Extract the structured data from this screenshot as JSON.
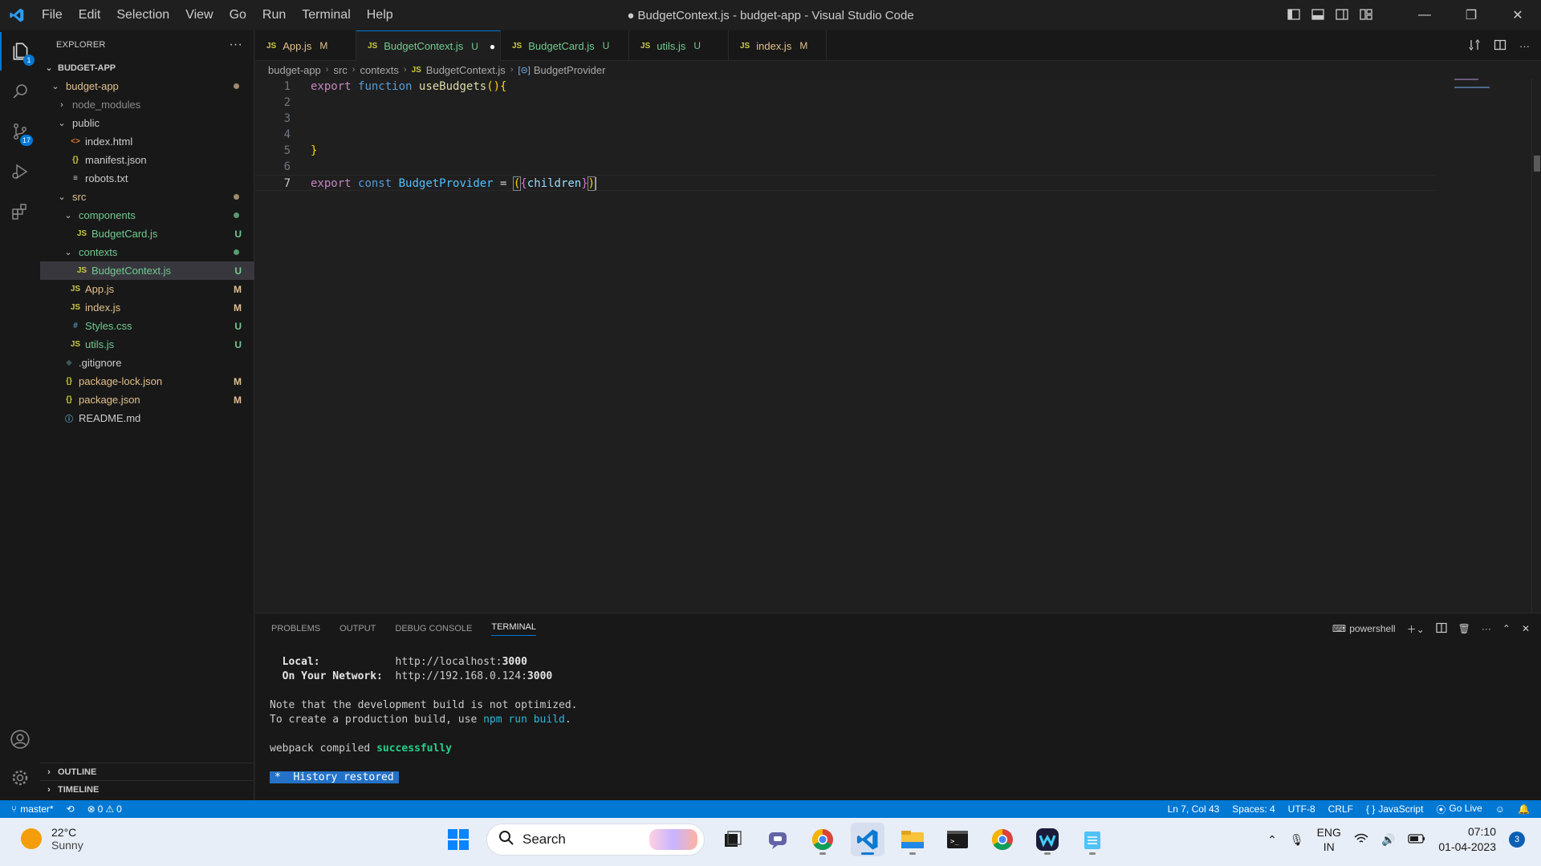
{
  "window": {
    "title": "● BudgetContext.js - budget-app - Visual Studio Code",
    "menu": [
      "File",
      "Edit",
      "Selection",
      "View",
      "Go",
      "Run",
      "Terminal",
      "Help"
    ]
  },
  "activity": {
    "explorer_badge": "1",
    "scm_badge": "17"
  },
  "sidebar": {
    "header": "EXPLORER",
    "more": "···",
    "root": "BUDGET-APP",
    "items": [
      {
        "label": "budget-app",
        "type": "folder",
        "open": true,
        "color": "mod",
        "marker": "dot-mod"
      },
      {
        "label": "node_modules",
        "type": "folder",
        "open": false,
        "color": "dim",
        "marker": ""
      },
      {
        "label": "public",
        "type": "folder",
        "open": true,
        "color": "plain",
        "marker": ""
      },
      {
        "label": "index.html",
        "type": "html",
        "color": "plain",
        "marker": ""
      },
      {
        "label": "manifest.json",
        "type": "json",
        "color": "plain",
        "marker": ""
      },
      {
        "label": "robots.txt",
        "type": "txt",
        "color": "plain",
        "marker": ""
      },
      {
        "label": "src",
        "type": "folder",
        "open": true,
        "color": "mod",
        "marker": "dot-mod"
      },
      {
        "label": "components",
        "type": "folder",
        "open": true,
        "color": "new",
        "marker": "dot-new"
      },
      {
        "label": "BudgetCard.js",
        "type": "js",
        "color": "new",
        "marker": "U"
      },
      {
        "label": "contexts",
        "type": "folder",
        "open": true,
        "color": "new",
        "marker": "dot-new"
      },
      {
        "label": "BudgetContext.js",
        "type": "js",
        "color": "new",
        "marker": "U",
        "selected": true
      },
      {
        "label": "App.js",
        "type": "js",
        "color": "mod",
        "marker": "M"
      },
      {
        "label": "index.js",
        "type": "js",
        "color": "mod",
        "marker": "M"
      },
      {
        "label": "Styles.css",
        "type": "css",
        "color": "new",
        "marker": "U"
      },
      {
        "label": "utils.js",
        "type": "js",
        "color": "new",
        "marker": "U"
      },
      {
        "label": ".gitignore",
        "type": "git",
        "color": "plain",
        "marker": ""
      },
      {
        "label": "package-lock.json",
        "type": "json",
        "color": "mod",
        "marker": "M"
      },
      {
        "label": "package.json",
        "type": "json",
        "color": "mod",
        "marker": "M"
      },
      {
        "label": "README.md",
        "type": "info",
        "color": "plain",
        "marker": ""
      }
    ],
    "outline": "OUTLINE",
    "timeline": "TIMELINE"
  },
  "tabs": [
    {
      "icon": "JS",
      "label": "App.js",
      "status": "M",
      "color": "mod"
    },
    {
      "icon": "JS",
      "label": "BudgetContext.js",
      "status": "U",
      "color": "new",
      "active": true,
      "dirty": "●"
    },
    {
      "icon": "JS",
      "label": "BudgetCard.js",
      "status": "U",
      "color": "new"
    },
    {
      "icon": "JS",
      "label": "utils.js",
      "status": "U",
      "color": "new"
    },
    {
      "icon": "JS",
      "label": "index.js",
      "status": "M",
      "color": "mod"
    }
  ],
  "breadcrumb": [
    "budget-app",
    "src",
    "contexts",
    "BudgetContext.js",
    "BudgetProvider"
  ],
  "editor": {
    "line_numbers": [
      "1",
      "2",
      "3",
      "4",
      "5",
      "6",
      "7"
    ],
    "current_line": "7"
  },
  "panel": {
    "tabs": [
      "PROBLEMS",
      "OUTPUT",
      "DEBUG CONSOLE",
      "TERMINAL"
    ],
    "active_tab": "TERMINAL",
    "shell": "powershell",
    "terminal": {
      "local_label": "Local:",
      "local_prefix": "http://localhost:",
      "local_port": "3000",
      "network_label": "On Your Network:",
      "network_prefix": "http://192.168.0.124:",
      "network_port": "3000",
      "note1": "Note that the development build is not optimized.",
      "note2_pre": "To create a production build, use ",
      "note2_cmd": "npm run build",
      "note2_post": ".",
      "compiled_pre": "webpack compiled ",
      "compiled_word": "successfully",
      "history": "*  History restored"
    }
  },
  "statusbar": {
    "branch": "master*",
    "errors": "0",
    "warnings": "0",
    "position": "Ln 7, Col 43",
    "spaces": "Spaces: 4",
    "encoding": "UTF-8",
    "eol": "CRLF",
    "language": "JavaScript",
    "golive": "Go Live"
  },
  "taskbar": {
    "temp": "22°C",
    "condition": "Sunny",
    "search_placeholder": "Search",
    "lang1": "ENG",
    "lang2": "IN",
    "time": "07:10",
    "date": "01-04-2023",
    "notifications": "3"
  },
  "colors": {
    "accent": "#0078d4",
    "modified": "#e2c08d",
    "untracked": "#73c991"
  }
}
